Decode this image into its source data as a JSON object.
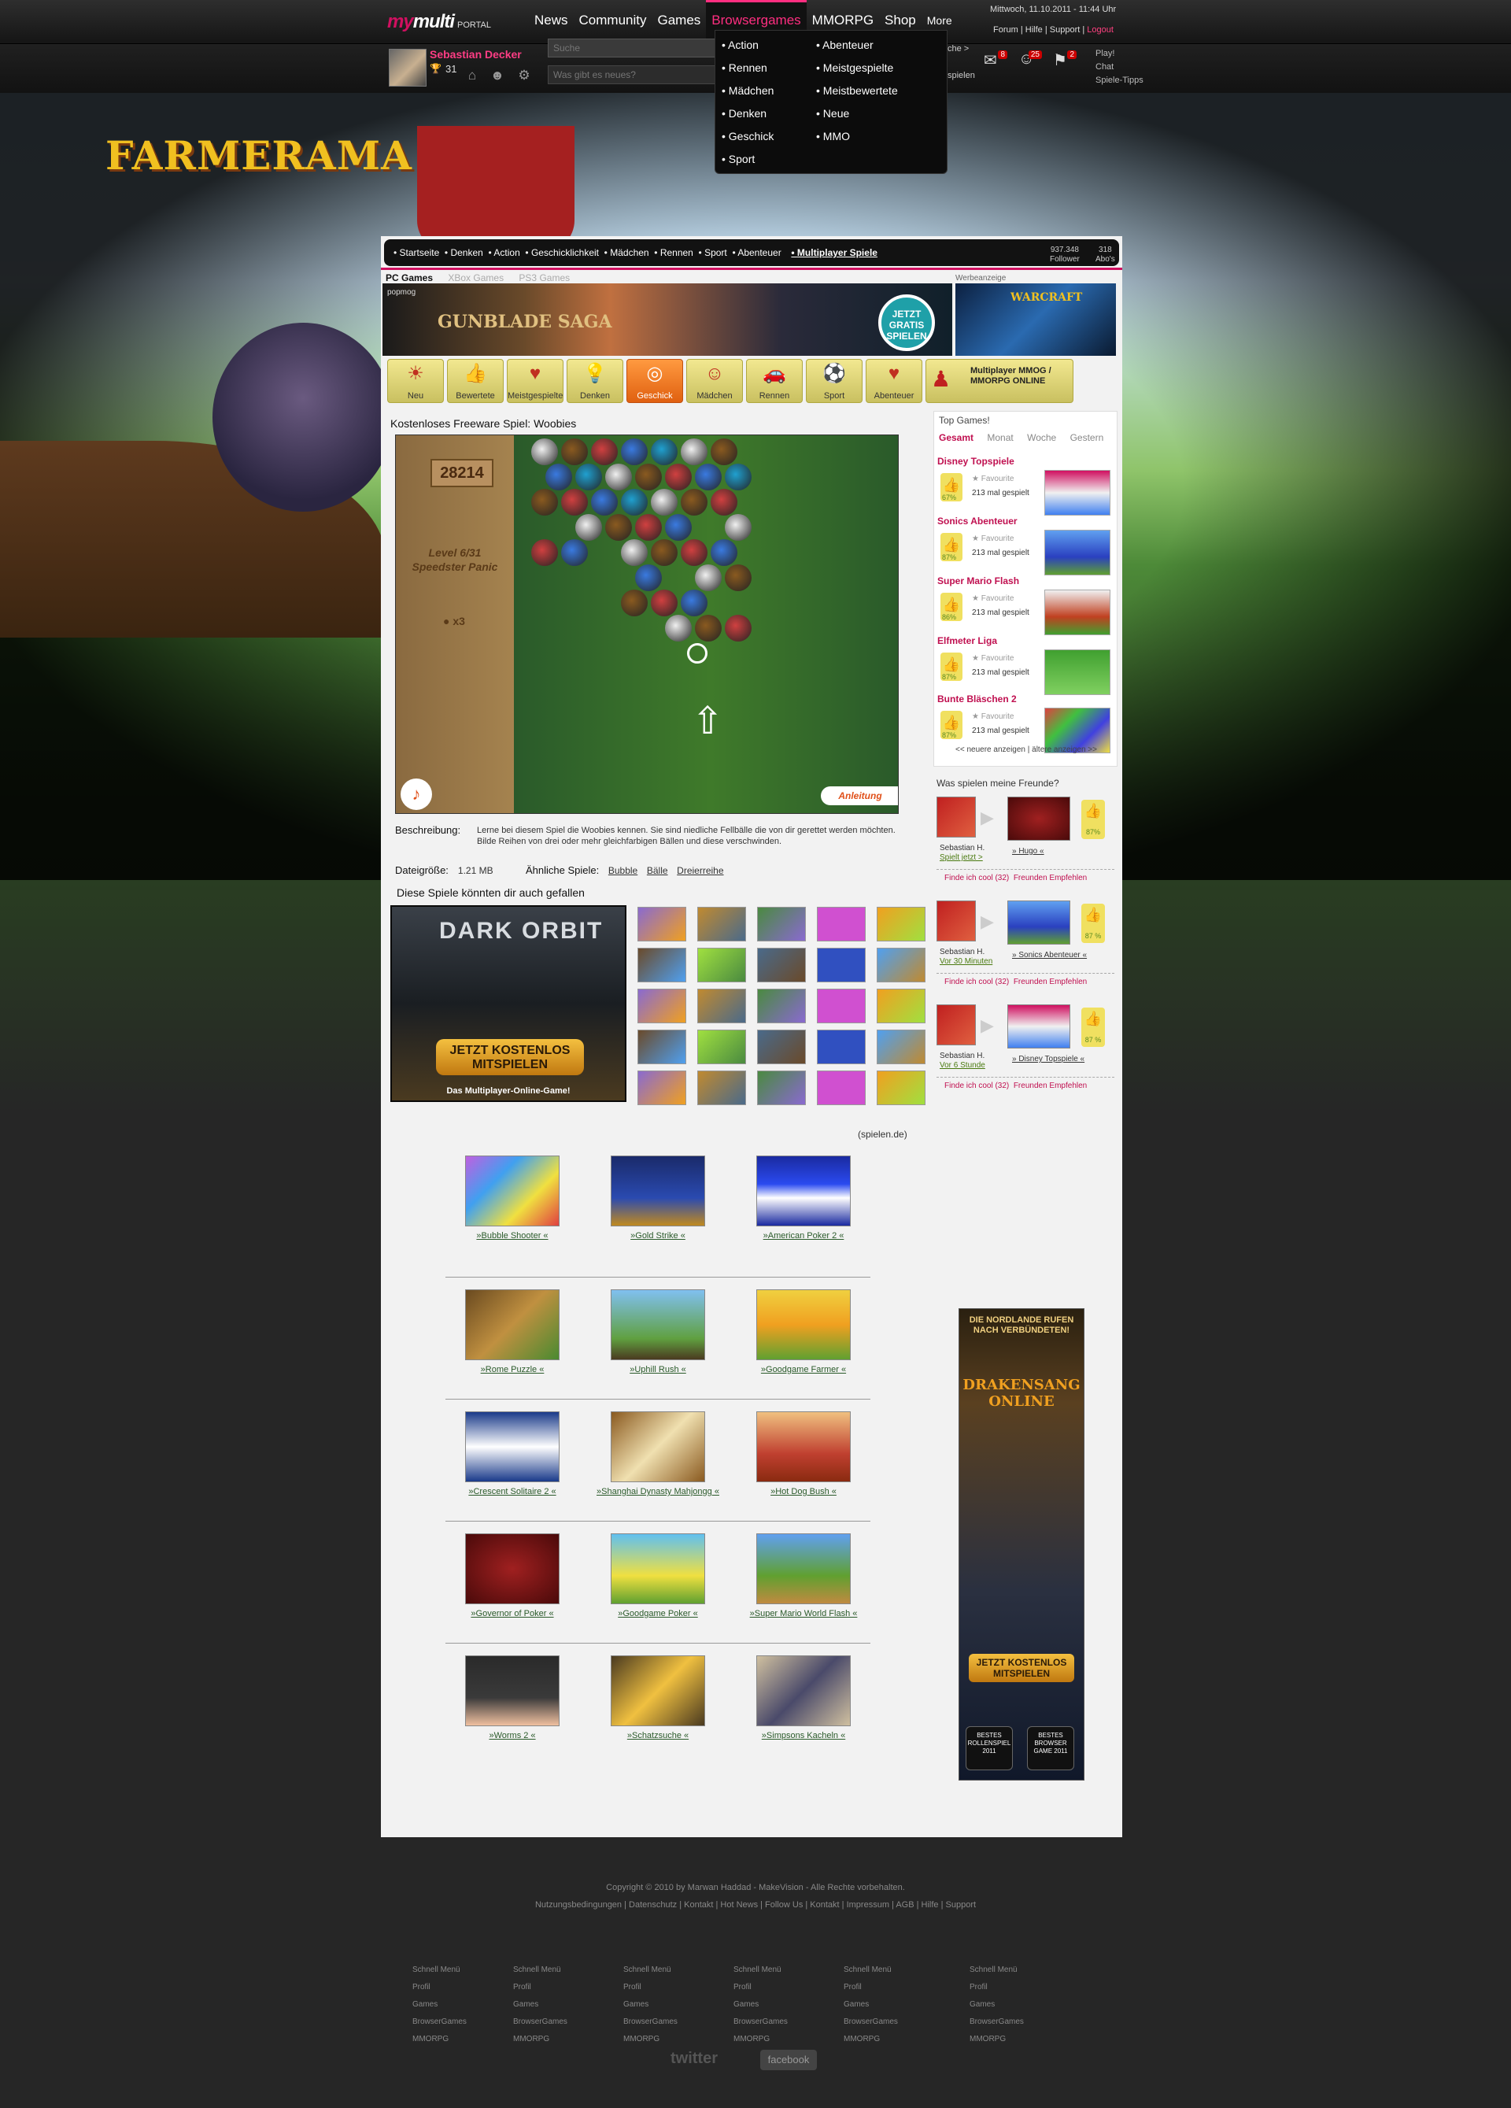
{
  "brand": {
    "logo_my": "my",
    "logo_multi": "multi",
    "logo_portal": "PORTAL"
  },
  "nav": {
    "items": [
      "News",
      "Community",
      "Games",
      "Browsergames",
      "MMORPG",
      "Shop",
      "More"
    ],
    "active": "Browsergames"
  },
  "datetime": "Mittwoch, 11.10.2011 - 11:44 Uhr",
  "toplinks": {
    "forum": "Forum",
    "hilfe": "Hilfe",
    "support": "Support",
    "logout": "Logout"
  },
  "user": {
    "name": "Sebastian Decker",
    "level": "31"
  },
  "search": {
    "placeholder": "Suche",
    "status_placeholder": "Was gibt es neues?"
  },
  "dropdown": {
    "col1": [
      "Action",
      "Rennen",
      "Mädchen",
      "Denken",
      "Geschick",
      "Sport"
    ],
    "col2": [
      "Abenteuer",
      "Meistgespielte",
      "Meistbewertete",
      "Neue",
      "MMO"
    ]
  },
  "dropdown_partial": {
    "a": "che >",
    "b": "spielen"
  },
  "notifications": {
    "a": "8",
    "b": "25",
    "c": "2"
  },
  "playmenu": [
    "Play!",
    "Chat",
    "Spiele-Tipps"
  ],
  "hero": {
    "game_logo": "FARMERAMA"
  },
  "catbar": {
    "items": [
      "Startseite",
      "Denken",
      "Action",
      "Geschicklichkeit",
      "Mädchen",
      "Rennen",
      "Sport",
      "Abenteuer"
    ],
    "multiplayer": "Multiplayer Spiele",
    "followers": "937.348",
    "followers_label": "Follower",
    "abos": "318",
    "abos_label": "Abo's"
  },
  "platforms": {
    "items": [
      "PC Games",
      "XBox Games",
      "PS3 Games"
    ],
    "active": "PC Games"
  },
  "ad_label": "Werbeanzeige",
  "banner1": {
    "brand": "popmog",
    "title": "GUNBLADE SAGA",
    "badge": "JETZT GRATIS SPIELEN"
  },
  "banner2": {
    "title": "WARCRAFT"
  },
  "tiles": [
    {
      "label": "Neu",
      "icon": "☀"
    },
    {
      "label": "Bewertete",
      "icon": "👍"
    },
    {
      "label": "Meistgespielte",
      "icon": "♥"
    },
    {
      "label": "Denken",
      "icon": "💡"
    },
    {
      "label": "Geschick",
      "icon": "◎"
    },
    {
      "label": "Mädchen",
      "icon": "☺"
    },
    {
      "label": "Rennen",
      "icon": "🚗"
    },
    {
      "label": "Sport",
      "icon": "⚽"
    },
    {
      "label": "Abenteuer",
      "icon": "♥"
    }
  ],
  "tiles_active": "Geschick",
  "multiplayer_tile": "Multiplayer MMOG / MMORPG ONLINE",
  "game": {
    "title": "Kostenloses Freeware Spiel: Woobies",
    "score": "28214",
    "level": "Level 6/31 Speedster Panic",
    "lives": "x3",
    "help": "Anleitung"
  },
  "description": {
    "label": "Beschreibung:",
    "text": "Lerne bei diesem Spiel die Woobies kennen. Sie sind niedliche Fellbälle die von dir gerettet werden möchten. Bilde Reihen von drei oder mehr gleichfarbigen Bällen und diese verschwinden."
  },
  "filesize": {
    "label": "Dateigröße:",
    "value": "1.21 MB"
  },
  "similar": {
    "label": "Ähnliche Spiele:",
    "items": [
      "Bubble",
      "Bälle",
      "Dreierreihe"
    ]
  },
  "gefallen": "Diese Spiele könnten dir auch gefallen",
  "darkorbit": {
    "title": "DARK ORBIT",
    "cta": "JETZT KOSTENLOS MITSPIELEN",
    "sub": "Das Multiplayer-Online-Game!"
  },
  "spielen_source": "(spielen.de)",
  "games": [
    [
      "»Bubble Shooter «",
      "»Gold Strike «",
      "»American Poker 2 «"
    ],
    [
      "»Rome Puzzle «",
      "»Uphill Rush «",
      "»Goodgame Farmer «"
    ],
    [
      "»Crescent Solitaire 2 «",
      "»Shanghai Dynasty Mahjongg «",
      "»Hot Dog Bush «"
    ],
    [
      "»Governor of Poker «",
      "»Goodgame Poker «",
      "»Super Mario World Flash «"
    ],
    [
      "»Worms 2 «",
      "»Schatzsuche «",
      "»Simpsons Kacheln «"
    ]
  ],
  "topgames": {
    "title": "Top Games!",
    "tabs": [
      "Gesamt",
      "Monat",
      "Woche",
      "Gestern"
    ],
    "active_tab": "Gesamt",
    "items": [
      {
        "name": "Disney Topspiele",
        "pct": "67%",
        "fav": "Favourite",
        "played": "213 mal gespielt"
      },
      {
        "name": "Sonics Abenteuer",
        "pct": "87%",
        "fav": "Favourite",
        "played": "213 mal gespielt"
      },
      {
        "name": "Super Mario Flash",
        "pct": "86%",
        "fav": "Favourite",
        "played": "213 mal gespielt"
      },
      {
        "name": "Elfmeter Liga",
        "pct": "87%",
        "fav": "Favourite",
        "played": "213 mal gespielt"
      },
      {
        "name": "Bunte Bläschen 2",
        "pct": "87%",
        "fav": "Favourite",
        "played": "213 mal gespielt"
      }
    ],
    "newer": "<< neuere anzeigen",
    "older": "ältere anzeigen >>"
  },
  "friends": {
    "title": "Was spielen meine Freunde?",
    "items": [
      {
        "who": "Sebastian H.",
        "when": "Spielt jetzt >",
        "game": "» Hugo «",
        "pct": "87%",
        "cool": "Finde ich cool (32)",
        "rec": "Freunden Empfehlen"
      },
      {
        "who": "Sebastian H.",
        "when": "Vor 30 Minuten",
        "game": "» Sonics Abenteuer «",
        "pct": "87 %",
        "cool": "Finde ich cool (32)",
        "rec": "Freunden Empfehlen"
      },
      {
        "who": "Sebastian H.",
        "when": "Vor 6 Stunde",
        "game": "» Disney Topspiele «",
        "pct": "87 %",
        "cool": "Finde ich cool (32)",
        "rec": "Freunden Empfehlen"
      }
    ]
  },
  "drakensang": {
    "tag": "DIE NORDLANDE RUFEN NACH VERBÜNDETEN!",
    "title": "DRAKENSANG ONLINE",
    "cta": "JETZT KOSTENLOS MITSPIELEN",
    "badge1": "BESTES ROLLENSPIEL 2011",
    "badge2": "BESTES BROWSER GAME 2011"
  },
  "footer": {
    "copyright": "Copyright © 2010 by Marwan Haddad - MakeVision - Alle Rechte vorbehalten.",
    "links": "Nutzungsbedingungen | Datenschutz | Kontakt | Hot News | Follow Us | Kontakt | Impressum | AGB | Hilfe | Support",
    "col_items": [
      "Schnell Menü",
      "Profil",
      "Games",
      "BrowserGames",
      "MMORPG"
    ],
    "twitter": "twitter",
    "facebook": "facebook"
  }
}
